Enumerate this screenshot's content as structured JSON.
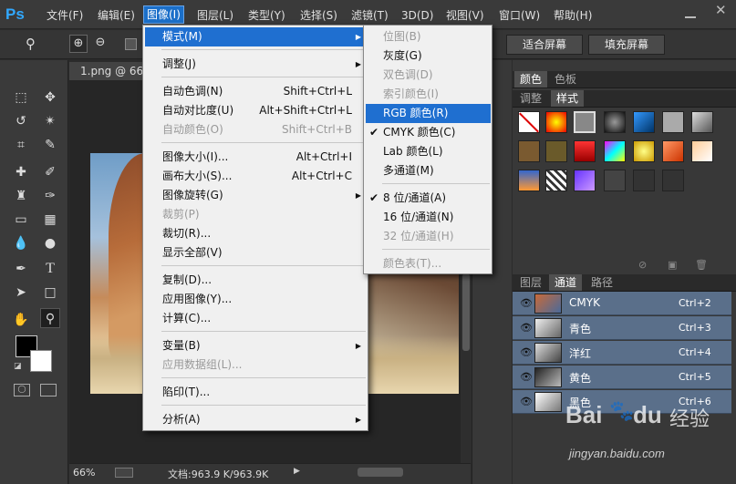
{
  "app": {
    "logo": "Ps"
  },
  "menubar": {
    "items": [
      "文件(F)",
      "编辑(E)",
      "图像(I)",
      "图层(L)",
      "类型(Y)",
      "选择(S)",
      "滤镜(T)",
      "3D(D)",
      "视图(V)",
      "窗口(W)",
      "帮助(H)"
    ]
  },
  "options_bar": {
    "fit_screen": "适合屏幕",
    "fill_screen": "填充屏幕"
  },
  "document": {
    "tab": "1.png @ 66%",
    "zoom": "66%",
    "doc_info": "文档:963.9 K/963.9K"
  },
  "image_menu": {
    "items": [
      {
        "label": "模式(M)",
        "shortcut": "",
        "submenu": true,
        "disabled": false,
        "highlighted": true
      },
      {
        "label": "调整(J)",
        "shortcut": "",
        "submenu": true,
        "disabled": false
      },
      {
        "label": "自动色调(N)",
        "shortcut": "Shift+Ctrl+L",
        "disabled": false
      },
      {
        "label": "自动对比度(U)",
        "shortcut": "Alt+Shift+Ctrl+L",
        "disabled": false
      },
      {
        "label": "自动颜色(O)",
        "shortcut": "Shift+Ctrl+B",
        "disabled": true
      },
      {
        "label": "图像大小(I)...",
        "shortcut": "Alt+Ctrl+I",
        "disabled": false
      },
      {
        "label": "画布大小(S)...",
        "shortcut": "Alt+Ctrl+C",
        "disabled": false
      },
      {
        "label": "图像旋转(G)",
        "shortcut": "",
        "submenu": true,
        "disabled": false
      },
      {
        "label": "裁剪(P)",
        "shortcut": "",
        "disabled": true
      },
      {
        "label": "裁切(R)...",
        "shortcut": "",
        "disabled": false
      },
      {
        "label": "显示全部(V)",
        "shortcut": "",
        "disabled": false
      },
      {
        "label": "复制(D)...",
        "shortcut": "",
        "disabled": false
      },
      {
        "label": "应用图像(Y)...",
        "shortcut": "",
        "disabled": false
      },
      {
        "label": "计算(C)...",
        "shortcut": "",
        "disabled": false
      },
      {
        "label": "变量(B)",
        "shortcut": "",
        "submenu": true,
        "disabled": false
      },
      {
        "label": "应用数据组(L)...",
        "shortcut": "",
        "disabled": true
      },
      {
        "label": "陷印(T)...",
        "shortcut": "",
        "disabled": false
      },
      {
        "label": "分析(A)",
        "shortcut": "",
        "submenu": true,
        "disabled": false
      }
    ]
  },
  "mode_menu": {
    "items": [
      {
        "label": "位图(B)",
        "disabled": true
      },
      {
        "label": "灰度(G)",
        "disabled": false
      },
      {
        "label": "双色调(D)",
        "disabled": true
      },
      {
        "label": "索引颜色(I)",
        "disabled": true
      },
      {
        "label": "RGB 颜色(R)",
        "disabled": false,
        "highlighted": true
      },
      {
        "label": "CMYK 颜色(C)",
        "disabled": false,
        "checked": true
      },
      {
        "label": "Lab 颜色(L)",
        "disabled": false
      },
      {
        "label": "多通道(M)",
        "disabled": false
      },
      {
        "label": "8 位/通道(A)",
        "disabled": false,
        "checked": true
      },
      {
        "label": "16 位/通道(N)",
        "disabled": false
      },
      {
        "label": "32 位/通道(H)",
        "disabled": true
      },
      {
        "label": "颜色表(T)...",
        "disabled": true
      }
    ]
  },
  "panels": {
    "top_tabs": [
      "颜色",
      "色板"
    ],
    "mid_tabs": [
      "调整",
      "样式"
    ],
    "bottom_tabs": [
      "图层",
      "通道",
      "路径"
    ]
  },
  "channels": [
    {
      "name": "CMYK",
      "shortcut": "Ctrl+2"
    },
    {
      "name": "青色",
      "shortcut": "Ctrl+3"
    },
    {
      "name": "洋红",
      "shortcut": "Ctrl+4"
    },
    {
      "name": "黄色",
      "shortcut": "Ctrl+5"
    },
    {
      "name": "黑色",
      "shortcut": "Ctrl+6"
    }
  ],
  "watermark": {
    "brand_a": "Bai",
    "brand_b": "du",
    "brand_c": "经验",
    "url": "jingyan.baidu.com"
  },
  "colors": {
    "accent": "#1f6fd0",
    "channel_row": "#5a6f8a"
  }
}
